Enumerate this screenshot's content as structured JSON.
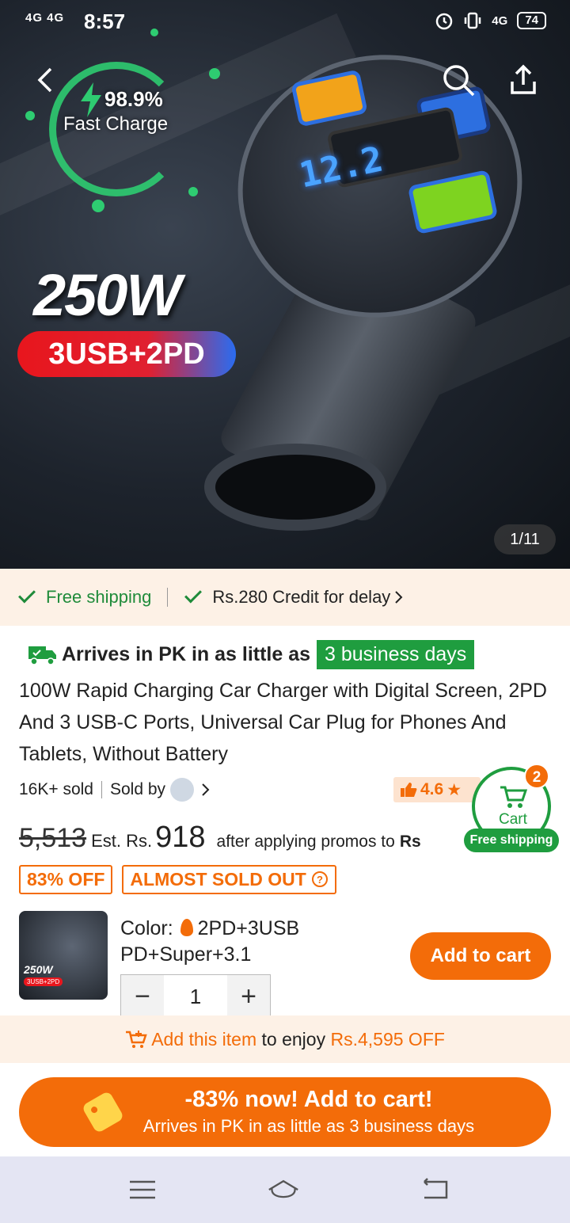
{
  "status_bar": {
    "signal": "4G 4G",
    "time": "8:57",
    "network": "4G",
    "battery": "74"
  },
  "hero": {
    "charge_percent": "98.9%",
    "charge_label": "Fast Charge",
    "wattage": "250W",
    "ports": "3USB+2PD",
    "lcd": "12.2",
    "image_counter": "1/11"
  },
  "shipping_strip": {
    "free_shipping": "Free shipping",
    "credit": "Rs.280 Credit for delay"
  },
  "arrival": {
    "prefix": "Arrives in PK in as little as",
    "badge": "3 business days"
  },
  "product": {
    "title": "100W Rapid Charging Car Charger with Digital Screen, 2PD And 3 USB-C Ports, Universal Car Plug for Phones And Tablets, Without Battery",
    "sold": "16K+ sold",
    "sold_by": "Sold by",
    "rating": "4.6",
    "old_price": "5,513",
    "est_label": "Est. Rs.",
    "price": "918",
    "promo_text": "after applying promos to",
    "promo_suffix": "Rs",
    "discount_tag": "83% OFF",
    "stock_tag": "ALMOST SOLD OUT"
  },
  "cart_float": {
    "count": "2",
    "label": "Cart",
    "free_shipping": "Free shipping"
  },
  "thumb": {
    "wattage": "250W",
    "ports": "3USB+2PD"
  },
  "variant": {
    "color_label": "Color:",
    "color_value": "2PD+3USB",
    "color_value_line2": "PD+Super+3.1",
    "quantity": "1",
    "minus": "−",
    "plus": "+"
  },
  "add_to_cart": "Add to cart",
  "add_bar": {
    "action": "Add this item",
    "middle": "to enjoy",
    "amount": "Rs.4,595 OFF"
  },
  "big_button": {
    "line1": "-83% now! Add to cart!",
    "line2": "Arrives in PK in as little as 3 business days"
  },
  "colors": {
    "accent": "#f36c09",
    "green": "#1f9d3f"
  }
}
